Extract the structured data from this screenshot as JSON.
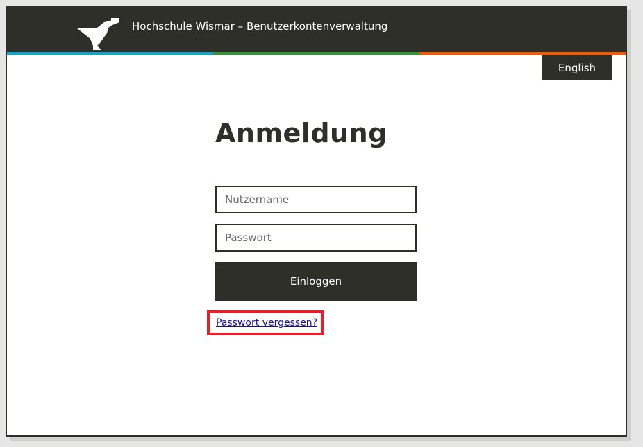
{
  "header": {
    "title": "Hochschule Wismar – Benutzerkontenverwaltung",
    "logo_icon": "binoculars-figure-logo-icon",
    "stripe_colors": [
      "#1ba3c6",
      "#3a8f3a",
      "#e85d12"
    ]
  },
  "language_button": {
    "label": "English"
  },
  "login": {
    "title": "Anmeldung",
    "username_placeholder": "Nutzername",
    "username_value": "",
    "password_placeholder": "Passwort",
    "password_value": "",
    "submit_label": "Einloggen",
    "forgot_password_label": "Passwort vergessen?"
  },
  "colors": {
    "header_bg": "#2e2f28",
    "highlight_border": "#e3202b",
    "link": "#1a0dab"
  }
}
